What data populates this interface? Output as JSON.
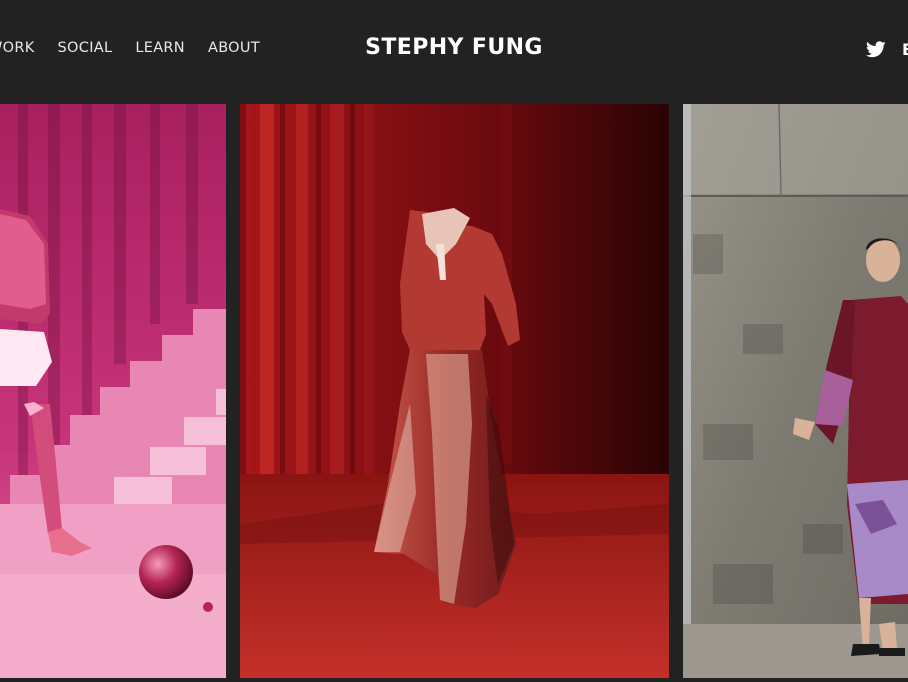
{
  "header": {
    "nav": [
      {
        "label": "WORK"
      },
      {
        "label": "SOCIAL"
      },
      {
        "label": "LEARN"
      },
      {
        "label": "ABOUT"
      }
    ],
    "brand": "STEPHY FUNG",
    "social_icon": "twitter-icon",
    "cut_off_item": "B"
  },
  "gallery": {
    "tiles": [
      {
        "subject": "pink-digital-outfit",
        "accent": "#e0478f"
      },
      {
        "subject": "red-digital-dress",
        "accent": "#b8262b"
      },
      {
        "subject": "model-purple-dress",
        "accent": "#7c3a8a"
      }
    ]
  },
  "colors": {
    "header_bg": "#222222",
    "text": "#ffffff"
  }
}
